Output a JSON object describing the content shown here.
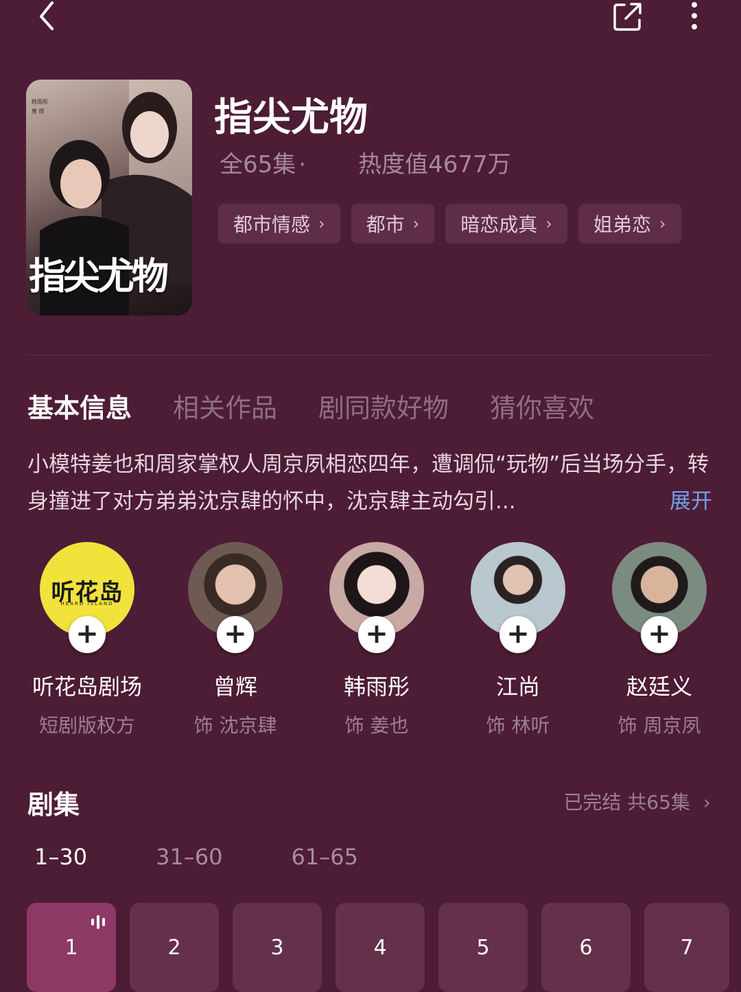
{
  "drama": {
    "title": "指尖尤物",
    "episodes_total_label": "全65集",
    "separator": "·",
    "heat_label": "热度值4677万",
    "poster": {
      "title_art": "指尖尤物",
      "credits": [
        "韩雨彤",
        "曾 辉"
      ]
    },
    "tags": [
      {
        "label": "都市情感"
      },
      {
        "label": "都市"
      },
      {
        "label": "暗恋成真"
      },
      {
        "label": "姐弟恋"
      }
    ]
  },
  "tabs": [
    {
      "label": "基本信息",
      "active": true
    },
    {
      "label": "相关作品",
      "active": false
    },
    {
      "label": "剧同款好物",
      "active": false
    },
    {
      "label": "猜你喜欢",
      "active": false
    }
  ],
  "synopsis": {
    "text": "小模特姜也和周家掌权人周京夙相恋四年，遭调侃“玩物”后当场分手，转身撞进了对方弟弟沈京肆的怀中，沈京肆主动勾引...",
    "expand_label": "展开"
  },
  "people": [
    {
      "name": "听花岛剧场",
      "role": "短剧版权方",
      "logo_text": "听花岛",
      "logo_sub": "HEARD ISLAND",
      "avatar_color": "#f2e23c"
    },
    {
      "name": "曾辉",
      "role": "饰 沈京肆",
      "avatar_color": "#6e5a52"
    },
    {
      "name": "韩雨彤",
      "role": "饰 姜也",
      "avatar_color": "#c9a9a3"
    },
    {
      "name": "江尚",
      "role": "饰 林听",
      "avatar_color": "#8d9aa0"
    },
    {
      "name": "赵廷义",
      "role": "饰 周京夙",
      "avatar_color": "#5e6f64"
    }
  ],
  "episodes_section": {
    "title": "剧集",
    "status": "已完结 共65集",
    "ranges": [
      {
        "label": "1–30",
        "active": true
      },
      {
        "label": "31–60",
        "active": false
      },
      {
        "label": "61–65",
        "active": false
      }
    ],
    "visible_episodes": [
      {
        "number": "1",
        "playing": true
      },
      {
        "number": "2",
        "playing": false
      },
      {
        "number": "3",
        "playing": false
      },
      {
        "number": "4",
        "playing": false
      },
      {
        "number": "5",
        "playing": false
      },
      {
        "number": "6",
        "playing": false
      },
      {
        "number": "7",
        "playing": false
      }
    ]
  },
  "icons": {
    "back": "chevron-left-icon",
    "share": "share-icon",
    "more": "more-vertical-icon",
    "tag_chevron": "chevron-right-icon",
    "follow": "plus-icon",
    "playing": "audio-bars-icon"
  },
  "colors": {
    "background": "#4d1c35",
    "tag_bg": "#5f2d47",
    "episode_bg": "#64304a",
    "episode_active_bg": "#8e3866",
    "link": "#6fa0ee"
  }
}
